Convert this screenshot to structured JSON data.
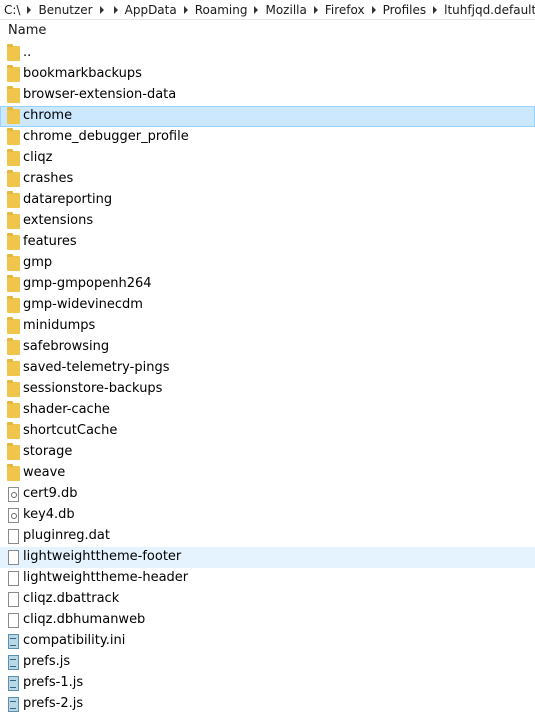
{
  "breadcrumb": [
    "C:\\",
    "Benutzer",
    "AppData",
    "Roaming",
    "Mozilla",
    "Firefox",
    "Profiles",
    "ltuhfjqd.default"
  ],
  "header": {
    "name": "Name"
  },
  "items": [
    {
      "name": "..",
      "type": "folder"
    },
    {
      "name": "bookmarkbackups",
      "type": "folder"
    },
    {
      "name": "browser-extension-data",
      "type": "folder"
    },
    {
      "name": "chrome",
      "type": "folder",
      "state": "selected"
    },
    {
      "name": "chrome_debugger_profile",
      "type": "folder"
    },
    {
      "name": "cliqz",
      "type": "folder"
    },
    {
      "name": "crashes",
      "type": "folder"
    },
    {
      "name": "datareporting",
      "type": "folder"
    },
    {
      "name": "extensions",
      "type": "folder"
    },
    {
      "name": "features",
      "type": "folder"
    },
    {
      "name": "gmp",
      "type": "folder"
    },
    {
      "name": "gmp-gmpopenh264",
      "type": "folder"
    },
    {
      "name": "gmp-widevinecdm",
      "type": "folder"
    },
    {
      "name": "minidumps",
      "type": "folder"
    },
    {
      "name": "safebrowsing",
      "type": "folder"
    },
    {
      "name": "saved-telemetry-pings",
      "type": "folder"
    },
    {
      "name": "sessionstore-backups",
      "type": "folder"
    },
    {
      "name": "shader-cache",
      "type": "folder"
    },
    {
      "name": "shortcutCache",
      "type": "folder"
    },
    {
      "name": "storage",
      "type": "folder"
    },
    {
      "name": "weave",
      "type": "folder"
    },
    {
      "name": "cert9.db",
      "type": "cert"
    },
    {
      "name": "key4.db",
      "type": "cert"
    },
    {
      "name": "pluginreg.dat",
      "type": "file"
    },
    {
      "name": "lightweighttheme-footer",
      "type": "file",
      "state": "hover"
    },
    {
      "name": "lightweighttheme-header",
      "type": "file"
    },
    {
      "name": "cliqz.dbattrack",
      "type": "file"
    },
    {
      "name": "cliqz.dbhumanweb",
      "type": "file"
    },
    {
      "name": "compatibility.ini",
      "type": "script"
    },
    {
      "name": "prefs.js",
      "type": "script"
    },
    {
      "name": "prefs-1.js",
      "type": "script"
    },
    {
      "name": "prefs-2.js",
      "type": "script"
    }
  ]
}
